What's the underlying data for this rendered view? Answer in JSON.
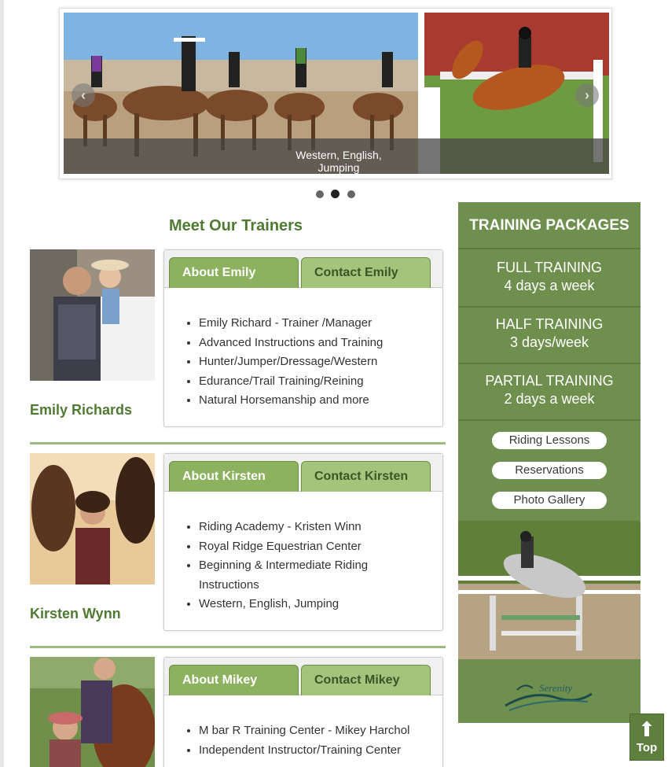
{
  "slider": {
    "caption": "Western, English, Jumping",
    "prev_icon": "chevron-left-icon",
    "next_icon": "chevron-right-icon",
    "dots_count": 3,
    "active_dot": 2
  },
  "meet_heading": "Meet Our Trainers",
  "trainers": [
    {
      "name": "Emily Richards",
      "tab_about": "About Emily",
      "tab_contact": "Contact Emily",
      "bullets": [
        "Emily Richard - Trainer /Manager",
        "Advanced Instructions and Training",
        "Hunter/Jumper/Dressage/Western",
        "Edurance/Trail Training/Reining",
        "Natural Horsemanship and more"
      ]
    },
    {
      "name": "Kirsten Wynn",
      "tab_about": "About Kirsten",
      "tab_contact": "Contact Kirsten",
      "bullets": [
        "Riding Academy - Kristen Winn",
        "Royal Ridge Equestrian Center",
        "Beginning & Intermediate Riding",
        "Instructions",
        "Western, English, Jumping"
      ]
    },
    {
      "name": "",
      "tab_about": "About Mikey",
      "tab_contact": "Contact Mikey",
      "bullets": [
        "M bar R Training Center - Mikey Harchol",
        "Independent Instructor/Training Center"
      ]
    }
  ],
  "sidebar": {
    "title": "TRAINING PACKAGES",
    "packages": [
      {
        "name": "FULL TRAINING",
        "detail": "4 days a week"
      },
      {
        "name": "HALF TRAINING",
        "detail": "3 days/week"
      },
      {
        "name": "PARTIAL TRAINING",
        "detail": "2 days a week"
      }
    ],
    "links": [
      "Riding Lessons",
      "Reservations",
      "Photo Gallery"
    ],
    "logo_text": "Serenity"
  },
  "top_button": {
    "label": "Top",
    "icon": "arrow-up-icon"
  },
  "colors": {
    "accent_green": "#6e8f4e",
    "tab_green": "#8cb15f",
    "heading_green": "#4f7a32"
  }
}
